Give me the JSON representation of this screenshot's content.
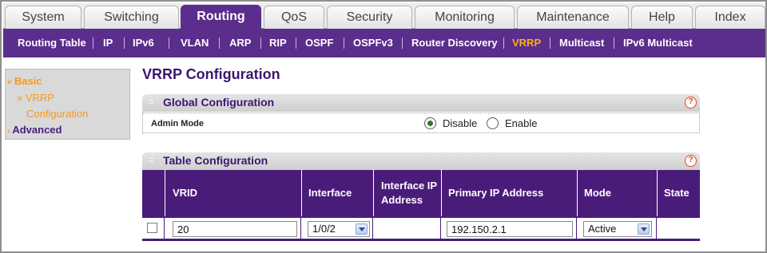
{
  "tabs": [
    "System",
    "Switching",
    "Routing",
    "QoS",
    "Security",
    "Monitoring",
    "Maintenance",
    "Help",
    "Index"
  ],
  "active_tab": "Routing",
  "subnav": [
    "Routing Table",
    "IP",
    "IPv6",
    "VLAN",
    "ARP",
    "RIP",
    "OSPF",
    "OSPFv3",
    "Router Discovery",
    "VRRP",
    "Multicast",
    "IPv6 Multicast"
  ],
  "active_subnav": "VRRP",
  "leftnav": {
    "basic": "Basic",
    "vrrp": "VRRP",
    "configuration": "Configuration",
    "advanced": "Advanced",
    "caret_open": "˅",
    "caret_closed": "›",
    "sub_marker": "»"
  },
  "page_title": "VRRP Configuration",
  "global": {
    "title": "Global Configuration",
    "admin_mode_label": "Admin Mode",
    "options": [
      "Disable",
      "Enable"
    ],
    "selected": "Disable"
  },
  "table": {
    "title": "Table Configuration",
    "headers": {
      "vrid": "VRID",
      "interface": "Interface",
      "interface_ip": "Interface IP Address",
      "primary_ip": "Primary IP Address",
      "mode": "Mode",
      "state": "State"
    },
    "row": {
      "vrid": "20",
      "interface": "1/0/2",
      "interface_ip": "",
      "primary_ip": "192.150.2.1",
      "mode": "Active",
      "state": ""
    }
  },
  "help_glyph": "?",
  "colors": {
    "brand_purple": "#5b2d8c",
    "table_purple": "#4a1c7a",
    "highlight_orange": "#f7b21c",
    "help_red": "#e2461c"
  }
}
